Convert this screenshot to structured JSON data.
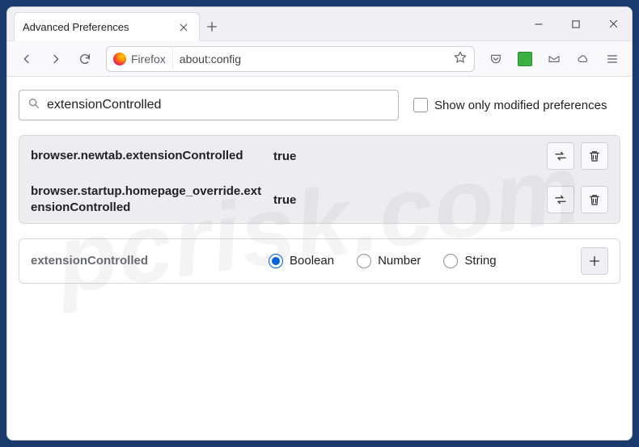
{
  "tab": {
    "title": "Advanced Preferences"
  },
  "urlbar": {
    "identity_label": "Firefox",
    "address": "about:config"
  },
  "search": {
    "value": "extensionControlled",
    "checkbox_label": "Show only modified preferences"
  },
  "prefs": [
    {
      "name": "browser.newtab.extensionControlled",
      "value": "true",
      "modified": true
    },
    {
      "name": "browser.startup.homepage_override.extensionControlled",
      "value": "true",
      "modified": true
    }
  ],
  "add_row": {
    "name": "extensionControlled",
    "types": [
      "Boolean",
      "Number",
      "String"
    ],
    "selected": "Boolean"
  },
  "watermark": "pcrisk.com"
}
